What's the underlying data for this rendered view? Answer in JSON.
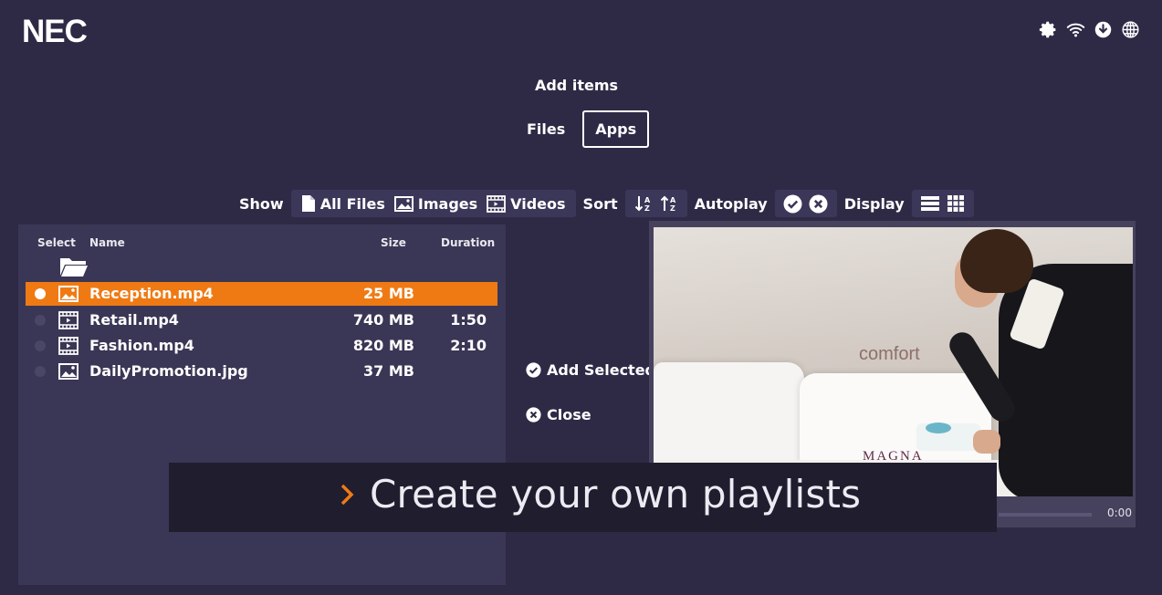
{
  "brand": {
    "logo_text": "NEC"
  },
  "system_icons": [
    "gear-icon",
    "wifi-icon",
    "download-icon",
    "globe-icon"
  ],
  "header": {
    "title": "Add items"
  },
  "tabs": [
    {
      "label": "Files",
      "active": false
    },
    {
      "label": "Apps",
      "active": true
    }
  ],
  "toolbar": {
    "show_label": "Show",
    "show_options": [
      "All Files",
      "Images",
      "Videos"
    ],
    "sort_label": "Sort",
    "autoplay_label": "Autoplay",
    "display_label": "Display"
  },
  "file_list": {
    "columns": {
      "select": "Select",
      "name": "Name",
      "size": "Size",
      "duration": "Duration"
    },
    "rows": [
      {
        "name": "Reception.mp4",
        "size": "25 MB",
        "duration": "",
        "icon": "image-icon",
        "selected": true
      },
      {
        "name": "Retail.mp4",
        "size": "740 MB",
        "duration": "1:50",
        "icon": "video-icon",
        "selected": false
      },
      {
        "name": "Fashion.mp4",
        "size": "820 MB",
        "duration": "2:10",
        "icon": "video-icon",
        "selected": false
      },
      {
        "name": "DailyPromotion.jpg",
        "size": "37 MB",
        "duration": "",
        "icon": "image-icon",
        "selected": false
      }
    ]
  },
  "actions": {
    "add_selected": "Add Selected",
    "close": "Close"
  },
  "preview": {
    "overlay_text_1": "comfort",
    "overlay_text_2": "MAGNA",
    "time": "0:00"
  },
  "caption": {
    "text": "Create your own playlists"
  },
  "colors": {
    "background": "#2e2a46",
    "panel": "#3a3655",
    "accent": "#ef7a14",
    "caption_bg": "#201d2f"
  }
}
